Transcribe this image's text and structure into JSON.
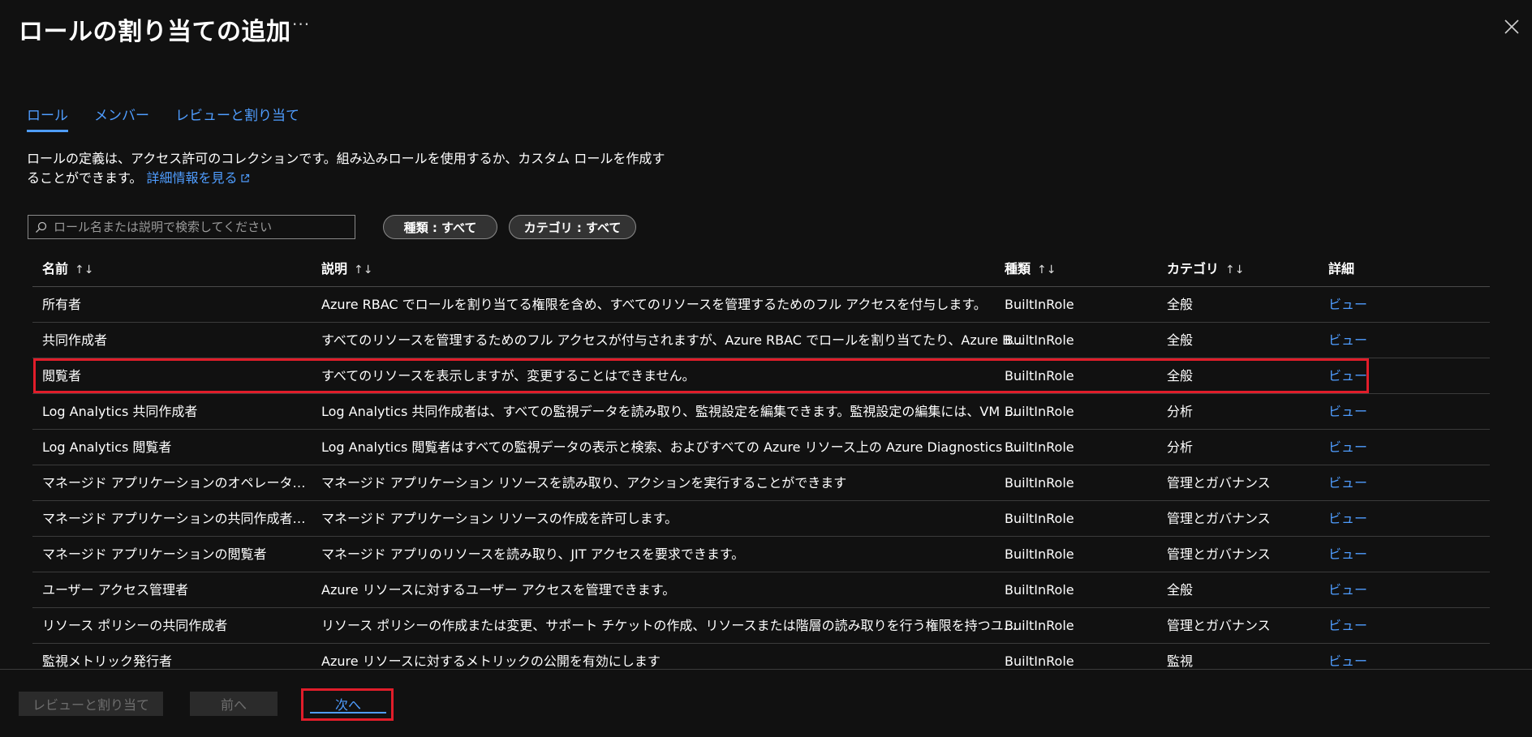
{
  "header": {
    "title": "ロールの割り当ての追加",
    "more_label": "···",
    "close_icon": "close-icon"
  },
  "tabs": [
    {
      "label": "ロール",
      "active": true
    },
    {
      "label": "メンバー",
      "active": false
    },
    {
      "label": "レビューと割り当て",
      "active": false
    }
  ],
  "description": {
    "text": "ロールの定義は、アクセス許可のコレクションです。組み込みロールを使用するか、カスタム ロールを作成することができます。",
    "link_label": "詳細情報を見る"
  },
  "search": {
    "placeholder": "ロール名または説明で検索してください",
    "value": ""
  },
  "filters": {
    "kind_label": "種類 : すべて",
    "category_label": "カテゴリ : すべて"
  },
  "table": {
    "columns": {
      "name": "名前",
      "description": "説明",
      "kind": "種類",
      "category": "カテゴリ",
      "details": "詳細"
    },
    "rows": [
      {
        "name": "所有者",
        "description": "Azure RBAC でロールを割り当てる権限を含め、すべてのリソースを管理するためのフル アクセスを付与します。",
        "kind": "BuiltInRole",
        "category": "全般",
        "details": "ビュー"
      },
      {
        "name": "共同作成者",
        "description": "すべてのリソースを管理するためのフル アクセスが付与されますが、Azure RBAC でロールを割り当てたり、Azure Bluepri...",
        "kind": "BuiltInRole",
        "category": "全般",
        "details": "ビュー"
      },
      {
        "name": "閲覧者",
        "description": "すべてのリソースを表示しますが、変更することはできません。",
        "kind": "BuiltInRole",
        "category": "全般",
        "details": "ビュー"
      },
      {
        "name": "Log Analytics 共同作成者",
        "description": "Log Analytics 共同作成者は、すべての監視データを読み取り、監視設定を編集できます。監視設定の編集には、VM ...",
        "kind": "BuiltInRole",
        "category": "分析",
        "details": "ビュー"
      },
      {
        "name": "Log Analytics 閲覧者",
        "description": "Log Analytics 閲覧者はすべての監視データの表示と検索、およびすべての Azure リソース上の Azure Diagnostics の...",
        "kind": "BuiltInRole",
        "category": "分析",
        "details": "ビュー"
      },
      {
        "name": "マネージド アプリケーションのオペレーター ロール",
        "description": "マネージド アプリケーション リソースを読み取り、アクションを実行することができます",
        "kind": "BuiltInRole",
        "category": "管理とガバナンス",
        "details": "ビュー"
      },
      {
        "name": "マネージド アプリケーションの共同作成者ロール",
        "description": "マネージド アプリケーション リソースの作成を許可します。",
        "kind": "BuiltInRole",
        "category": "管理とガバナンス",
        "details": "ビュー"
      },
      {
        "name": "マネージド アプリケーションの閲覧者",
        "description": "マネージド アプリのリソースを読み取り、JIT アクセスを要求できます。",
        "kind": "BuiltInRole",
        "category": "管理とガバナンス",
        "details": "ビュー"
      },
      {
        "name": "ユーザー アクセス管理者",
        "description": "Azure リソースに対するユーザー アクセスを管理できます。",
        "kind": "BuiltInRole",
        "category": "全般",
        "details": "ビュー"
      },
      {
        "name": "リソース ポリシーの共同作成者",
        "description": "リソース ポリシーの作成または変更、サポート チケットの作成、リソースまたは階層の読み取りを行う権限を持つユーザー。",
        "kind": "BuiltInRole",
        "category": "管理とガバナンス",
        "details": "ビュー"
      },
      {
        "name": "監視メトリック発行者",
        "description": "Azure リソースに対するメトリックの公開を有効にします",
        "kind": "BuiltInRole",
        "category": "監視",
        "details": "ビュー"
      }
    ]
  },
  "footer": {
    "review_label": "レビューと割り当て",
    "prev_label": "前へ",
    "next_label": "次へ"
  },
  "colors": {
    "background": "#111111",
    "link": "#4f9dff",
    "highlight": "#e11d2a"
  }
}
